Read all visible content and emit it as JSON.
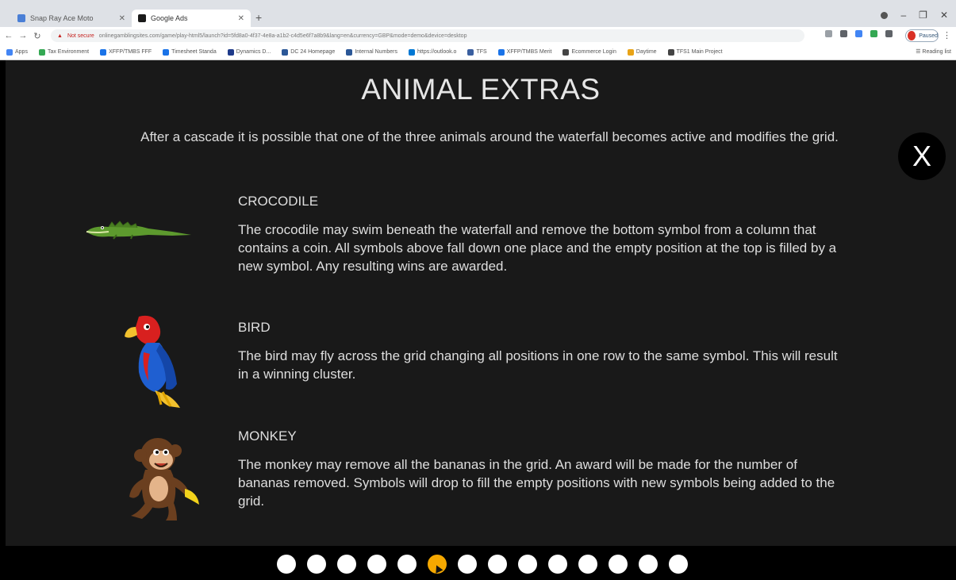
{
  "browser": {
    "tabs": [
      {
        "title": "Snap Ray Ace Moto",
        "favicon_color": "#4a7fd6"
      },
      {
        "title": "Google Ads",
        "favicon_color": "#1a1a1a"
      }
    ],
    "new_tab_label": "+",
    "address": {
      "security_label": "Not secure",
      "url": "onlinegamblingsites.com/game/play-html5/launch?id=5fd8a0-4f37-4e8a-a1b2-c4d5e6f7a8b9&lang=en&currency=GBP&mode=demo&device=desktop"
    },
    "profile_label": "Paused",
    "bookmarks": [
      {
        "label": "Apps",
        "color": "#4285f4"
      },
      {
        "label": "Tax Environment",
        "color": "#34a853"
      },
      {
        "label": "XFFP/TMBS FFF",
        "color": "#1a73e8"
      },
      {
        "label": "Timesheet Standa",
        "color": "#1a73e8"
      },
      {
        "label": "Dynamics D...",
        "color": "#1e3a8a"
      },
      {
        "label": "DC 24 Homepage",
        "color": "#2b5797"
      },
      {
        "label": "Internal Numbers",
        "color": "#2b5797"
      },
      {
        "label": "https://outlook.o",
        "color": "#0078d4"
      },
      {
        "label": "TFS",
        "color": "#3a5f9f"
      },
      {
        "label": "XFFP/TMBS Merit",
        "color": "#1a73e8"
      },
      {
        "label": "Ecommerce Login",
        "color": "#444444"
      },
      {
        "label": "Daytime",
        "color": "#e8a317"
      },
      {
        "label": "TFS1 Main Project",
        "color": "#444444"
      }
    ],
    "reading_list_label": "Reading list"
  },
  "help": {
    "title": "ANIMAL EXTRAS",
    "intro": "After a cascade it is possible that one of the three animals around the waterfall becomes active and modifies the grid.",
    "close_label": "X",
    "sections": [
      {
        "heading": "CROCODILE",
        "body": "The crocodile may swim beneath the waterfall and remove the bottom symbol from a column that contains a coin. All symbols above fall down one place and the empty position at the top is filled by a new symbol. Any resulting wins are awarded.",
        "icon": "crocodile-icon"
      },
      {
        "heading": "BIRD",
        "body": "The bird may fly across the grid changing all positions in one row to the same symbol. This will result in a winning cluster.",
        "icon": "parrot-icon"
      },
      {
        "heading": "MONKEY",
        "body": "The monkey may remove all the bananas in the grid. An award will be made for the number of bananas removed. Symbols will drop to fill the empty positions with new symbols being added to the grid.",
        "icon": "monkey-icon"
      }
    ]
  },
  "pagination": {
    "total_pages": 14,
    "current_page": 6,
    "active_color": "#f5a800",
    "inactive_color": "#ffffff"
  }
}
